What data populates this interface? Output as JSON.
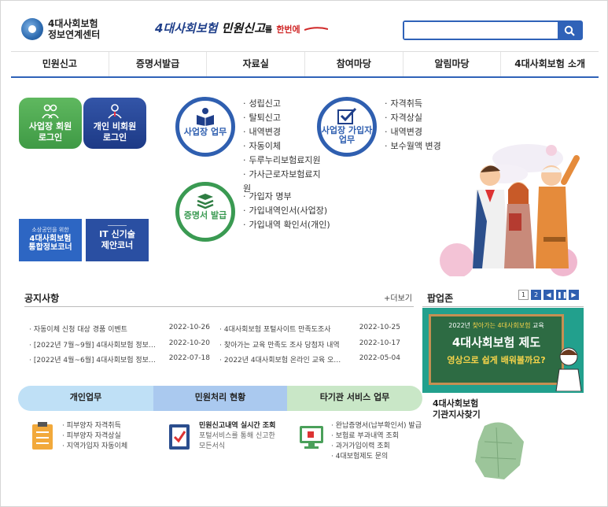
{
  "header": {
    "logo_line1": "4대사회보험",
    "logo_line2": "정보연계센터",
    "slogan_blue1": "4대사회보험",
    "slogan_blue2": "민원신고",
    "slogan_tail": "를",
    "slogan_red": "한번에",
    "search_placeholder": ""
  },
  "gnb": [
    "민원신고",
    "증명서발급",
    "자료실",
    "참여마당",
    "알림마당",
    "4대사회보험 소개"
  ],
  "login": {
    "business_line1": "사업장 회원",
    "business_line2": "로그인",
    "personal_line1": "개인 비회원",
    "personal_line2": "로그인"
  },
  "banners": {
    "b1_small": "소상공인을 위한",
    "b1_line1": "4대사회보험",
    "b1_line2": "통합정보코너",
    "b2_line1": "IT 신기술",
    "b2_line2": "제안코너"
  },
  "services": {
    "biz_label": "사업장 업무",
    "biz_items": [
      "성립신고",
      "탈퇴신고",
      "내역변경",
      "자동이체",
      "두루누리보험료지원",
      "가사근로자보험료지원"
    ],
    "sub_label_line1": "사업장 가입자",
    "sub_label_line2": "업무",
    "sub_items": [
      "자격취득",
      "자격상실",
      "내역변경",
      "보수월액 변경"
    ],
    "cert_label": "증명서 발급",
    "cert_items": [
      "가입자 명부",
      "가입내역인서(사업장)",
      "가입내역 확인서(개인)"
    ]
  },
  "notice": {
    "title": "공지사항",
    "more": "+더보기",
    "rows": [
      {
        "title": "자동이체 신청 대상 경품 이벤트",
        "date": "2022-10-26"
      },
      {
        "title": "4대사회보험 포털사이트 만족도조사",
        "date": "2022-10-25"
      },
      {
        "title": "[2022년 7월~9월] 4대사회보험 정보…",
        "date": "2022-10-20"
      },
      {
        "title": "찾아가는 교육 만족도 조사 당첨자 내역",
        "date": "2022-10-17"
      },
      {
        "title": "[2022년 4월~6월] 4대사회보험 정보…",
        "date": "2022-07-18"
      },
      {
        "title": "2022년 4대사회보험 온라인 교육 오…",
        "date": "2022-05-04"
      }
    ]
  },
  "popup": {
    "title": "팝업존",
    "pages": [
      "1",
      "2"
    ],
    "board_sub_prefix": "2022년 ",
    "board_sub_hl": "찾아가는 4대사회보험",
    "board_sub_suffix": " 교육",
    "board_main": "4대사회보험 제도",
    "board_yellow": "영상으로 쉽게 배워볼까요?",
    "branch_line1": "4대사회보험",
    "branch_line2": "기관지사찾기"
  },
  "tabs": [
    "개인업무",
    "민원처리 현황",
    "타기관 서비스 업무"
  ],
  "personal_service": [
    "피부양자 자격취득",
    "피부양자 자격상실",
    "지역가입자 자동이체"
  ],
  "status_service": {
    "lead": "민원신고내역 실시간 조회",
    "sub1": "포털서비스를 통해 신고한",
    "sub2": "모든서식"
  },
  "other_service": [
    "완납증명서(납부확인서) 발급",
    "보험료 부과내역 조회",
    "과거가입이력 조회",
    "4대보험제도 문의"
  ],
  "colors": {
    "primary": "#2f5fb0",
    "green": "#3a9a52",
    "accent_red": "#d02828"
  }
}
